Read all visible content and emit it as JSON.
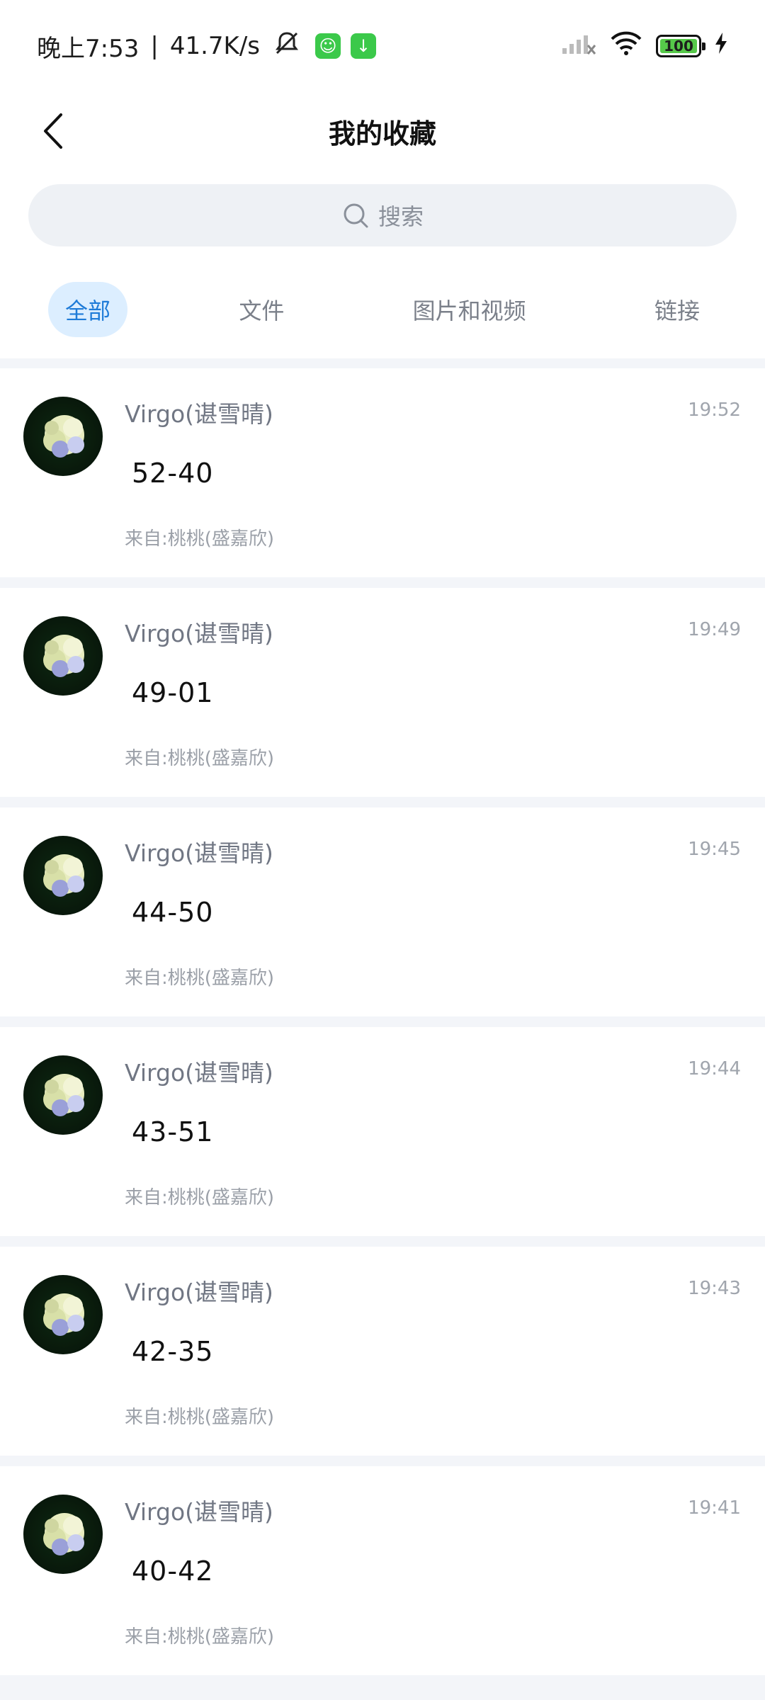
{
  "status_bar": {
    "time": "晚上7:53",
    "separator": "|",
    "speed": "41.7K/s",
    "battery": "100"
  },
  "header": {
    "title": "我的收藏"
  },
  "search": {
    "placeholder": "搜索"
  },
  "tabs": [
    {
      "label": "全部",
      "active": true
    },
    {
      "label": "文件",
      "active": false
    },
    {
      "label": "图片和视频",
      "active": false
    },
    {
      "label": "链接",
      "active": false
    }
  ],
  "items": [
    {
      "sender": "Virgo(谌雪晴)",
      "time": "19:52",
      "content": "52-40",
      "source": "来自:桃桃(盛嘉欣)"
    },
    {
      "sender": "Virgo(谌雪晴)",
      "time": "19:49",
      "content": "49-01",
      "source": "来自:桃桃(盛嘉欣)"
    },
    {
      "sender": "Virgo(谌雪晴)",
      "time": "19:45",
      "content": "44-50",
      "source": "来自:桃桃(盛嘉欣)"
    },
    {
      "sender": "Virgo(谌雪晴)",
      "time": "19:44",
      "content": "43-51",
      "source": "来自:桃桃(盛嘉欣)"
    },
    {
      "sender": "Virgo(谌雪晴)",
      "time": "19:43",
      "content": "42-35",
      "source": "来自:桃桃(盛嘉欣)"
    },
    {
      "sender": "Virgo(谌雪晴)",
      "time": "19:41",
      "content": "40-42",
      "source": "来自:桃桃(盛嘉欣)"
    }
  ],
  "colors": {
    "accent": "#1e7bd8",
    "tab_active_bg": "#dceeff",
    "page_bg": "#f3f5f9"
  }
}
